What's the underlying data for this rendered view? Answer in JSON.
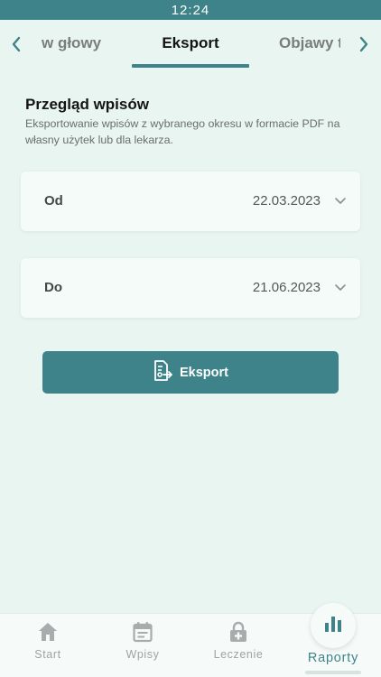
{
  "status_bar": {
    "time": "12:24"
  },
  "tabs": {
    "previous": "w głowy",
    "current": "Eksport",
    "next": "Objawy t"
  },
  "report": {
    "title": "Przegląd wpisów",
    "description": "Eksportowanie wpisów z wybranego okresu w formacie PDF na własny użytek lub dla lekarza.",
    "from_label": "Od",
    "from_value": "22.03.2023",
    "to_label": "Do",
    "to_value": "21.06.2023",
    "export_label": "Eksport"
  },
  "bottom_nav": {
    "items": [
      {
        "label": "Start",
        "icon": "home-icon"
      },
      {
        "label": "Wpisy",
        "icon": "calendar-icon"
      },
      {
        "label": "Leczenie",
        "icon": "medical-lock-icon"
      },
      {
        "label": "Raporty",
        "icon": "bar-chart-icon"
      }
    ],
    "active": "Raporty"
  },
  "colors": {
    "accent": "#3d8389",
    "background": "#e9f5f1",
    "card": "#f5fbf9",
    "inactive": "#9ea3a3"
  }
}
